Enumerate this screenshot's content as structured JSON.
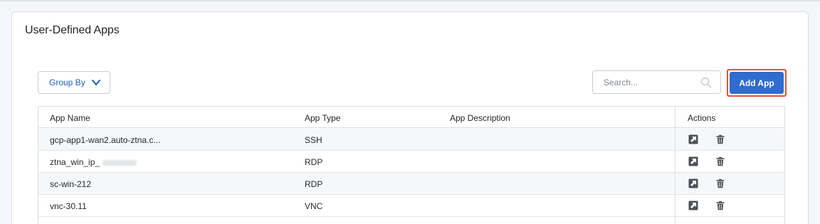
{
  "panel": {
    "title": "User-Defined Apps"
  },
  "toolbar": {
    "group_by_label": "Group By",
    "search_placeholder": "Search...",
    "add_app_label": "Add App"
  },
  "table": {
    "columns": [
      "App Name",
      "App Type",
      "App Description",
      "Actions"
    ],
    "rows": [
      {
        "name": "gcp-app1-wan2.auto-ztna.c...",
        "type": "SSH",
        "description": ""
      },
      {
        "name": "ztna_win_ip_",
        "type": "RDP",
        "description": ""
      },
      {
        "name": "sc-win-212",
        "type": "RDP",
        "description": ""
      },
      {
        "name": "vnc-30.11",
        "type": "VNC",
        "description": ""
      }
    ],
    "row_actions": [
      "open-external-icon",
      "trash-icon"
    ]
  },
  "colors": {
    "accent": "#2f6ccf",
    "highlight": "#e2552a",
    "link": "#1a5fb4"
  }
}
